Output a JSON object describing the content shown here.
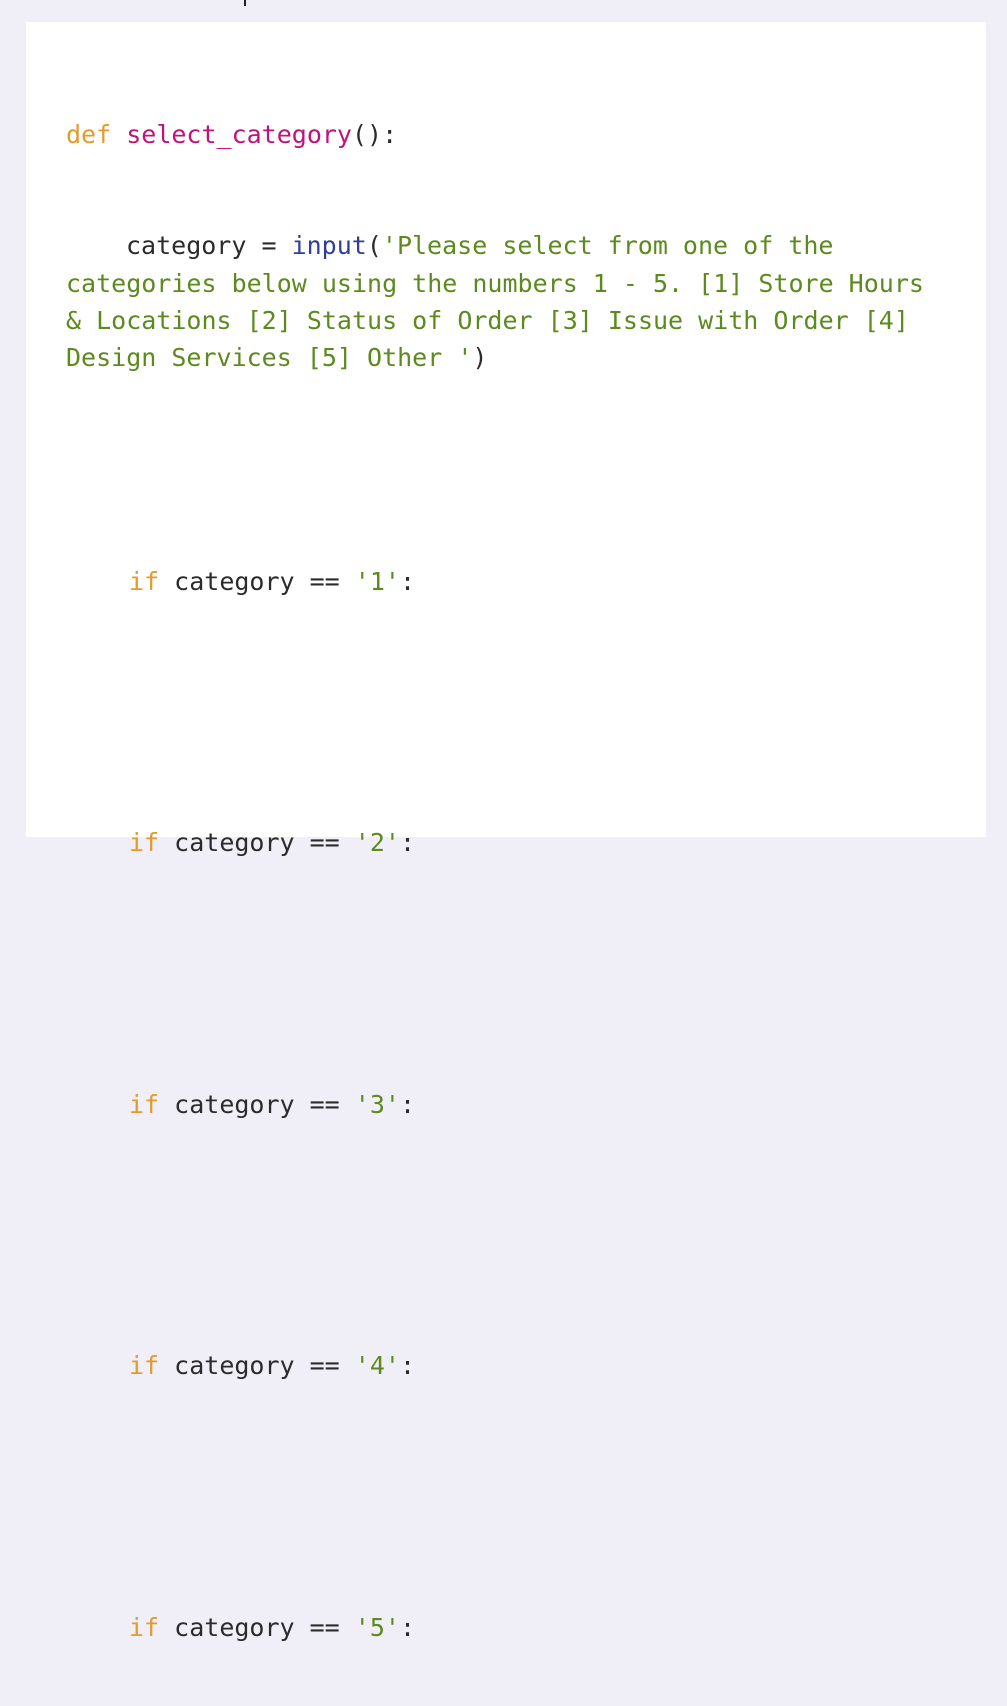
{
  "code": {
    "def_keyword": "def",
    "function_name": "select_category",
    "function_tail": "():",
    "assign_var": "category",
    "assign_op": " = ",
    "input_func": "input",
    "paren_open": "(",
    "prompt_string": "'Please select from one of the categories below using the numbers 1 - 5. [1] Store Hours & Locations [2] Status of Order [3] Issue with Order [4] Design Services [5] Other '",
    "paren_close": ")",
    "if_blocks": [
      {
        "keyword": "if",
        "condition": " category == ",
        "value": "'1'",
        "colon": ":"
      },
      {
        "keyword": "if",
        "condition": " category == ",
        "value": "'2'",
        "colon": ":"
      },
      {
        "keyword": "if",
        "condition": " category == ",
        "value": "'3'",
        "colon": ":"
      },
      {
        "keyword": "if",
        "condition": " category == ",
        "value": "'4'",
        "colon": ":"
      },
      {
        "keyword": "if",
        "condition": " category == ",
        "value": "'5'",
        "colon": ":"
      }
    ]
  },
  "colors": {
    "keyword": "#e39b2c",
    "function_name": "#c0127b",
    "builtin": "#2f3f95",
    "string": "#5d8a1e",
    "plain": "#2b2b2b",
    "page_background": "#f0eff7",
    "panel_background": "#ffffff"
  }
}
